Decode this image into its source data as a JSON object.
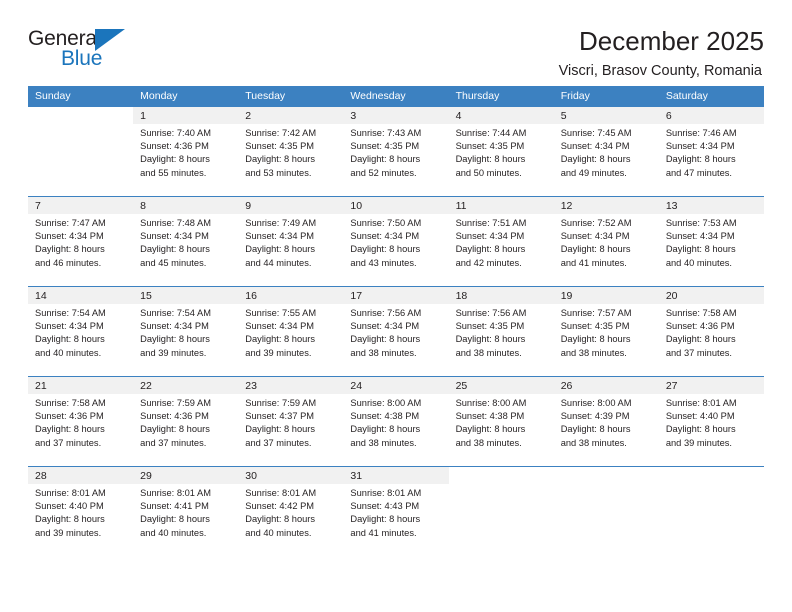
{
  "brand": {
    "word_one": "General",
    "word_two": "Blue",
    "accent_color": "#1b75bc",
    "triangle_icon": "triangle-icon"
  },
  "header": {
    "title": "December 2025",
    "subtitle": "Viscri, Brasov County, Romania"
  },
  "calendar": {
    "header_bg": "#3c81c1",
    "daynum_bg": "#f1f1f1",
    "weekday_headers": [
      "Sunday",
      "Monday",
      "Tuesday",
      "Wednesday",
      "Thursday",
      "Friday",
      "Saturday"
    ],
    "weeks": [
      [
        {
          "day": "",
          "empty": true
        },
        {
          "day": "1",
          "sunrise": "Sunrise: 7:40 AM",
          "sunset": "Sunset: 4:36 PM",
          "daylight_1": "Daylight: 8 hours",
          "daylight_2": "and 55 minutes."
        },
        {
          "day": "2",
          "sunrise": "Sunrise: 7:42 AM",
          "sunset": "Sunset: 4:35 PM",
          "daylight_1": "Daylight: 8 hours",
          "daylight_2": "and 53 minutes."
        },
        {
          "day": "3",
          "sunrise": "Sunrise: 7:43 AM",
          "sunset": "Sunset: 4:35 PM",
          "daylight_1": "Daylight: 8 hours",
          "daylight_2": "and 52 minutes."
        },
        {
          "day": "4",
          "sunrise": "Sunrise: 7:44 AM",
          "sunset": "Sunset: 4:35 PM",
          "daylight_1": "Daylight: 8 hours",
          "daylight_2": "and 50 minutes."
        },
        {
          "day": "5",
          "sunrise": "Sunrise: 7:45 AM",
          "sunset": "Sunset: 4:34 PM",
          "daylight_1": "Daylight: 8 hours",
          "daylight_2": "and 49 minutes."
        },
        {
          "day": "6",
          "sunrise": "Sunrise: 7:46 AM",
          "sunset": "Sunset: 4:34 PM",
          "daylight_1": "Daylight: 8 hours",
          "daylight_2": "and 47 minutes."
        }
      ],
      [
        {
          "day": "7",
          "sunrise": "Sunrise: 7:47 AM",
          "sunset": "Sunset: 4:34 PM",
          "daylight_1": "Daylight: 8 hours",
          "daylight_2": "and 46 minutes."
        },
        {
          "day": "8",
          "sunrise": "Sunrise: 7:48 AM",
          "sunset": "Sunset: 4:34 PM",
          "daylight_1": "Daylight: 8 hours",
          "daylight_2": "and 45 minutes."
        },
        {
          "day": "9",
          "sunrise": "Sunrise: 7:49 AM",
          "sunset": "Sunset: 4:34 PM",
          "daylight_1": "Daylight: 8 hours",
          "daylight_2": "and 44 minutes."
        },
        {
          "day": "10",
          "sunrise": "Sunrise: 7:50 AM",
          "sunset": "Sunset: 4:34 PM",
          "daylight_1": "Daylight: 8 hours",
          "daylight_2": "and 43 minutes."
        },
        {
          "day": "11",
          "sunrise": "Sunrise: 7:51 AM",
          "sunset": "Sunset: 4:34 PM",
          "daylight_1": "Daylight: 8 hours",
          "daylight_2": "and 42 minutes."
        },
        {
          "day": "12",
          "sunrise": "Sunrise: 7:52 AM",
          "sunset": "Sunset: 4:34 PM",
          "daylight_1": "Daylight: 8 hours",
          "daylight_2": "and 41 minutes."
        },
        {
          "day": "13",
          "sunrise": "Sunrise: 7:53 AM",
          "sunset": "Sunset: 4:34 PM",
          "daylight_1": "Daylight: 8 hours",
          "daylight_2": "and 40 minutes."
        }
      ],
      [
        {
          "day": "14",
          "sunrise": "Sunrise: 7:54 AM",
          "sunset": "Sunset: 4:34 PM",
          "daylight_1": "Daylight: 8 hours",
          "daylight_2": "and 40 minutes."
        },
        {
          "day": "15",
          "sunrise": "Sunrise: 7:54 AM",
          "sunset": "Sunset: 4:34 PM",
          "daylight_1": "Daylight: 8 hours",
          "daylight_2": "and 39 minutes."
        },
        {
          "day": "16",
          "sunrise": "Sunrise: 7:55 AM",
          "sunset": "Sunset: 4:34 PM",
          "daylight_1": "Daylight: 8 hours",
          "daylight_2": "and 39 minutes."
        },
        {
          "day": "17",
          "sunrise": "Sunrise: 7:56 AM",
          "sunset": "Sunset: 4:34 PM",
          "daylight_1": "Daylight: 8 hours",
          "daylight_2": "and 38 minutes."
        },
        {
          "day": "18",
          "sunrise": "Sunrise: 7:56 AM",
          "sunset": "Sunset: 4:35 PM",
          "daylight_1": "Daylight: 8 hours",
          "daylight_2": "and 38 minutes."
        },
        {
          "day": "19",
          "sunrise": "Sunrise: 7:57 AM",
          "sunset": "Sunset: 4:35 PM",
          "daylight_1": "Daylight: 8 hours",
          "daylight_2": "and 38 minutes."
        },
        {
          "day": "20",
          "sunrise": "Sunrise: 7:58 AM",
          "sunset": "Sunset: 4:36 PM",
          "daylight_1": "Daylight: 8 hours",
          "daylight_2": "and 37 minutes."
        }
      ],
      [
        {
          "day": "21",
          "sunrise": "Sunrise: 7:58 AM",
          "sunset": "Sunset: 4:36 PM",
          "daylight_1": "Daylight: 8 hours",
          "daylight_2": "and 37 minutes."
        },
        {
          "day": "22",
          "sunrise": "Sunrise: 7:59 AM",
          "sunset": "Sunset: 4:36 PM",
          "daylight_1": "Daylight: 8 hours",
          "daylight_2": "and 37 minutes."
        },
        {
          "day": "23",
          "sunrise": "Sunrise: 7:59 AM",
          "sunset": "Sunset: 4:37 PM",
          "daylight_1": "Daylight: 8 hours",
          "daylight_2": "and 37 minutes."
        },
        {
          "day": "24",
          "sunrise": "Sunrise: 8:00 AM",
          "sunset": "Sunset: 4:38 PM",
          "daylight_1": "Daylight: 8 hours",
          "daylight_2": "and 38 minutes."
        },
        {
          "day": "25",
          "sunrise": "Sunrise: 8:00 AM",
          "sunset": "Sunset: 4:38 PM",
          "daylight_1": "Daylight: 8 hours",
          "daylight_2": "and 38 minutes."
        },
        {
          "day": "26",
          "sunrise": "Sunrise: 8:00 AM",
          "sunset": "Sunset: 4:39 PM",
          "daylight_1": "Daylight: 8 hours",
          "daylight_2": "and 38 minutes."
        },
        {
          "day": "27",
          "sunrise": "Sunrise: 8:01 AM",
          "sunset": "Sunset: 4:40 PM",
          "daylight_1": "Daylight: 8 hours",
          "daylight_2": "and 39 minutes."
        }
      ],
      [
        {
          "day": "28",
          "sunrise": "Sunrise: 8:01 AM",
          "sunset": "Sunset: 4:40 PM",
          "daylight_1": "Daylight: 8 hours",
          "daylight_2": "and 39 minutes."
        },
        {
          "day": "29",
          "sunrise": "Sunrise: 8:01 AM",
          "sunset": "Sunset: 4:41 PM",
          "daylight_1": "Daylight: 8 hours",
          "daylight_2": "and 40 minutes."
        },
        {
          "day": "30",
          "sunrise": "Sunrise: 8:01 AM",
          "sunset": "Sunset: 4:42 PM",
          "daylight_1": "Daylight: 8 hours",
          "daylight_2": "and 40 minutes."
        },
        {
          "day": "31",
          "sunrise": "Sunrise: 8:01 AM",
          "sunset": "Sunset: 4:43 PM",
          "daylight_1": "Daylight: 8 hours",
          "daylight_2": "and 41 minutes."
        },
        {
          "day": "",
          "empty": true
        },
        {
          "day": "",
          "empty": true
        },
        {
          "day": "",
          "empty": true
        }
      ]
    ]
  }
}
